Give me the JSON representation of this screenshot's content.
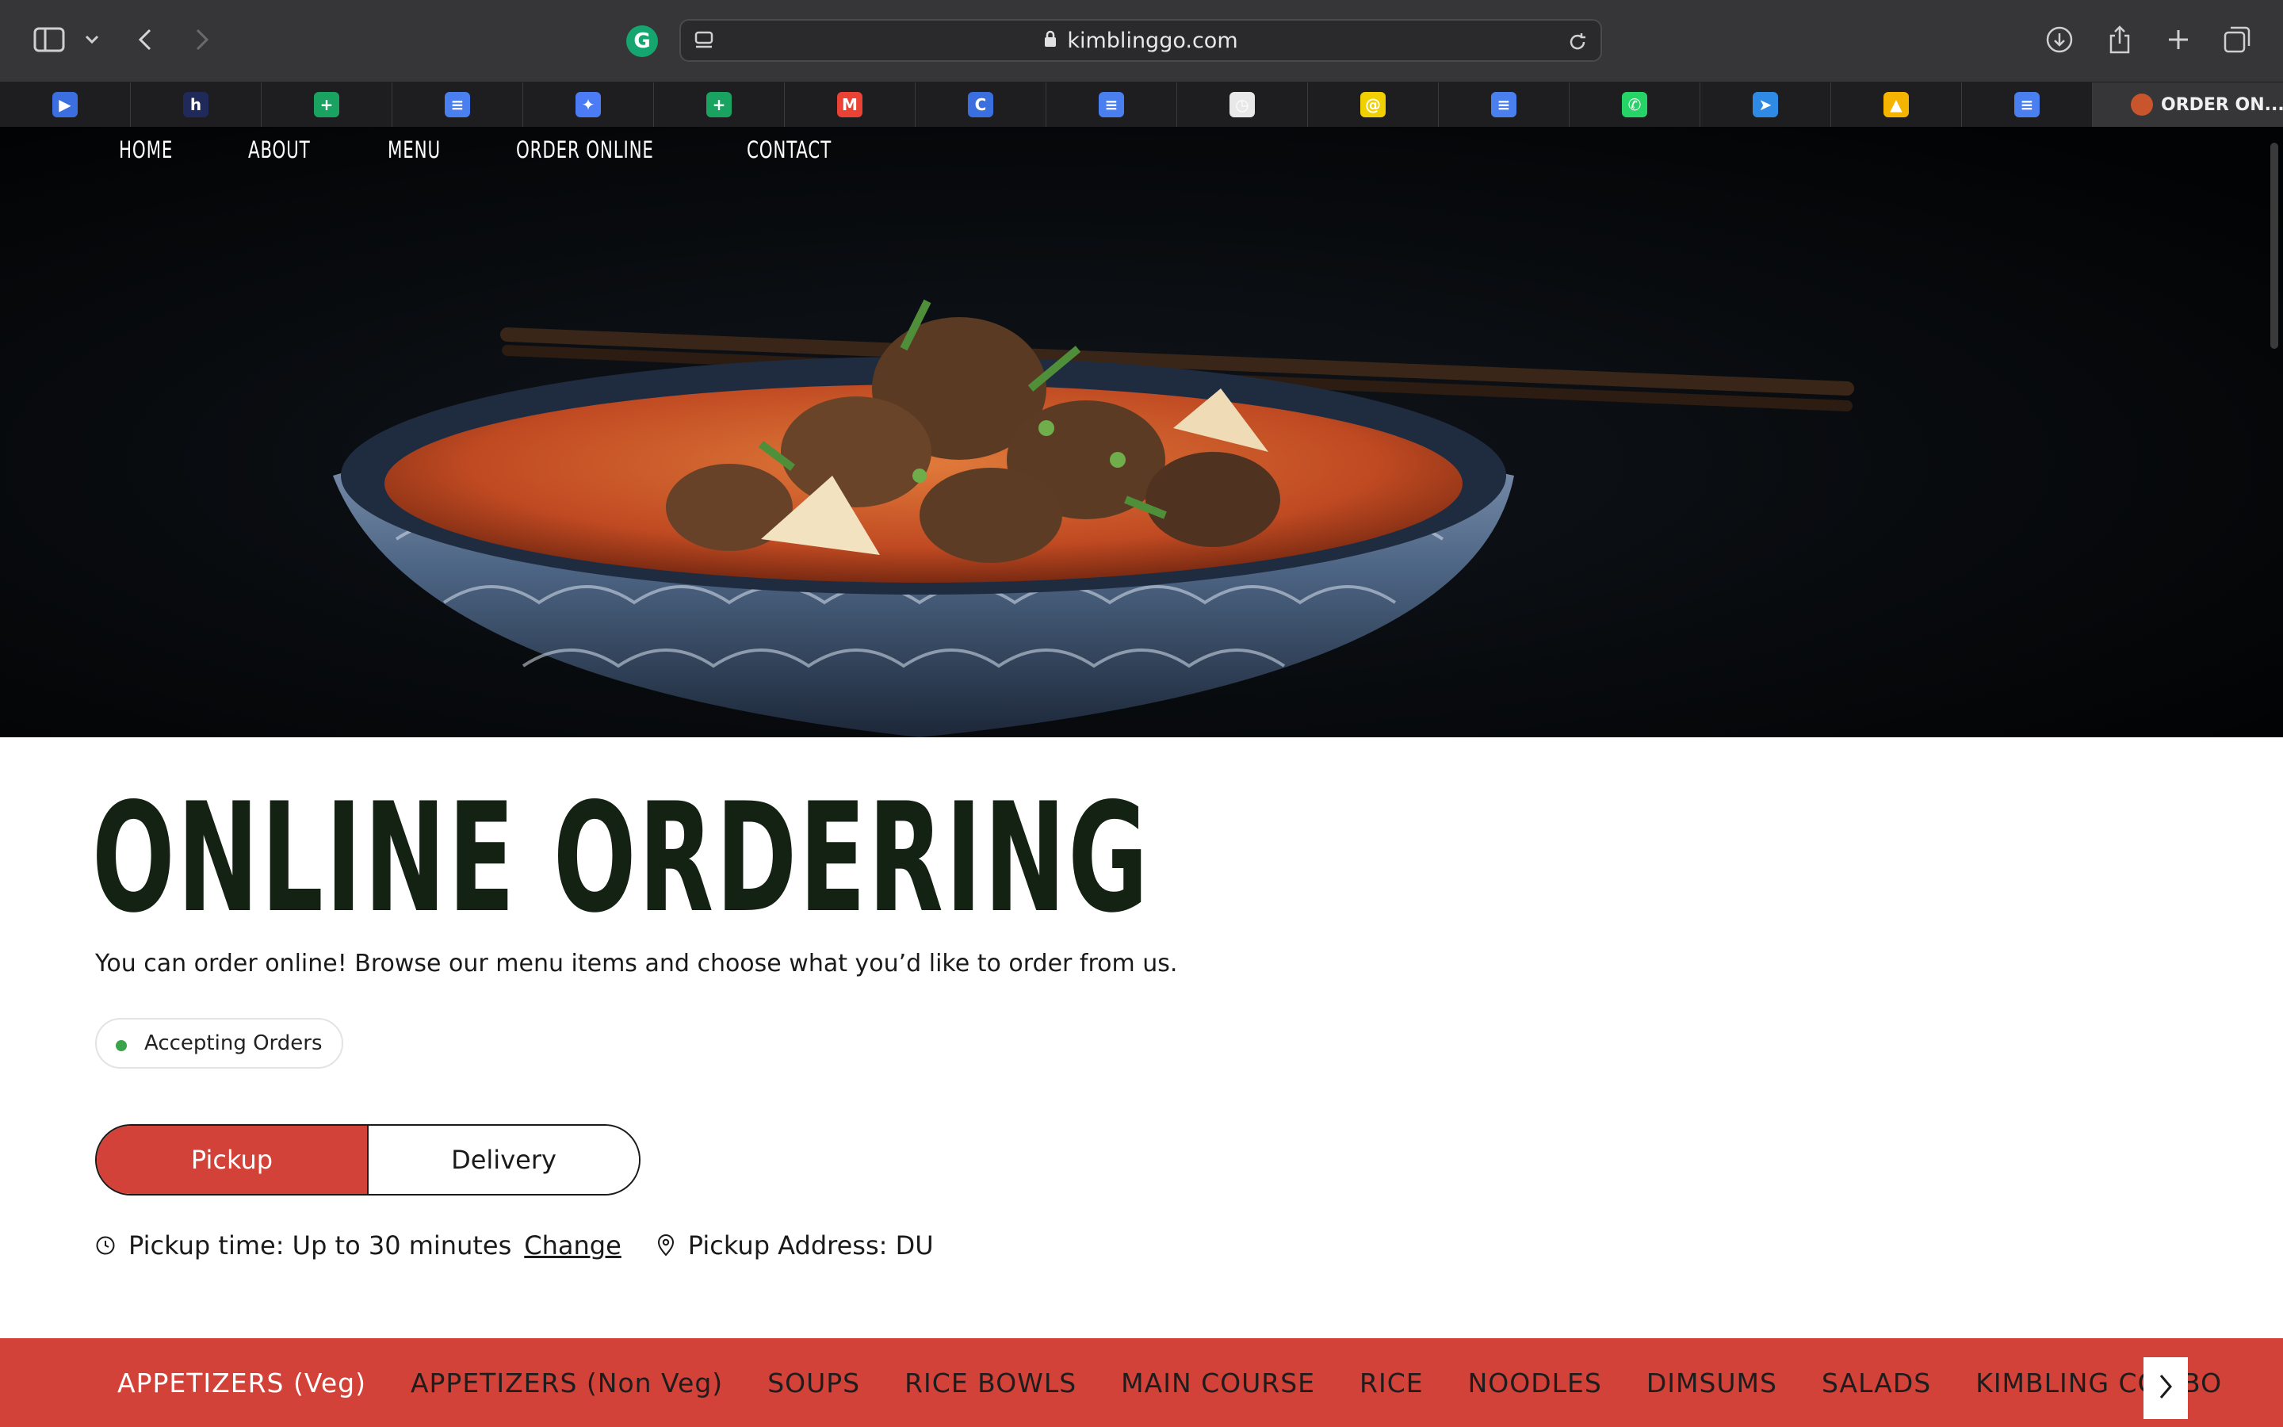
{
  "browser": {
    "url": "kimblinggo.com",
    "grammarly_letter": "G",
    "tabs": [
      {
        "icon": "play-circle-icon",
        "color": "#3b6fe0",
        "glyph": "▶"
      },
      {
        "icon": "hackerrank-h-icon",
        "color": "#1f2a5a",
        "glyph": "h"
      },
      {
        "icon": "google-sheets-icon",
        "color": "#1aa260",
        "glyph": "+"
      },
      {
        "icon": "google-docs-icon",
        "color": "#4a7ff0",
        "glyph": "≡"
      },
      {
        "icon": "gemini-sparkle-icon",
        "color": "#4b7bf5",
        "glyph": "✦"
      },
      {
        "icon": "google-sheets-icon",
        "color": "#1aa260",
        "glyph": "+"
      },
      {
        "icon": "gmail-icon",
        "color": "#ea4335",
        "glyph": "M"
      },
      {
        "icon": "canva-c-icon",
        "color": "#3a6fe0",
        "glyph": "C"
      },
      {
        "icon": "google-docs-icon",
        "color": "#4a7ff0",
        "glyph": "≡"
      },
      {
        "icon": "clock-badge-icon",
        "color": "#e8e8e8",
        "glyph": "◷"
      },
      {
        "icon": "mailchimp-icon",
        "color": "#f0d000",
        "glyph": "@"
      },
      {
        "icon": "google-docs-icon",
        "color": "#4a7ff0",
        "glyph": "≡"
      },
      {
        "icon": "whatsapp-icon",
        "color": "#25d366",
        "glyph": "✆"
      },
      {
        "icon": "telegram-icon",
        "color": "#2f8ae5",
        "glyph": "➤"
      },
      {
        "icon": "google-drive-icon",
        "color": "#f5b400",
        "glyph": "▲"
      },
      {
        "icon": "google-docs-icon",
        "color": "#4a7ff0",
        "glyph": "≡"
      }
    ],
    "active_tab_label": "ORDER ON..."
  },
  "nav": {
    "items": [
      "HOME",
      "ABOUT",
      "MENU",
      "ORDER ONLINE",
      "CONTACT"
    ]
  },
  "page": {
    "title": "ONLINE ORDERING",
    "subtitle": "You can order online! Browse our menu items and choose what you’d like to order from us.",
    "status": "Accepting Orders",
    "modes": [
      "Pickup",
      "Delivery"
    ],
    "selected_mode": "Pickup",
    "pickup_time": "Pickup time: Up to 30 minutes",
    "change_label": "Change",
    "pickup_address": "Pickup Address: DU"
  },
  "categories": [
    "APPETIZERS (Veg)",
    "APPETIZERS (Non Veg)",
    "SOUPS",
    "RICE BOWLS",
    "MAIN COURSE",
    "RICE",
    "NOODLES",
    "DIMSUMS",
    "SALADS",
    "KIMBLING COMBO"
  ],
  "colors": {
    "accent": "#d24238",
    "title": "#142214",
    "status_dot": "#3aa34b"
  }
}
